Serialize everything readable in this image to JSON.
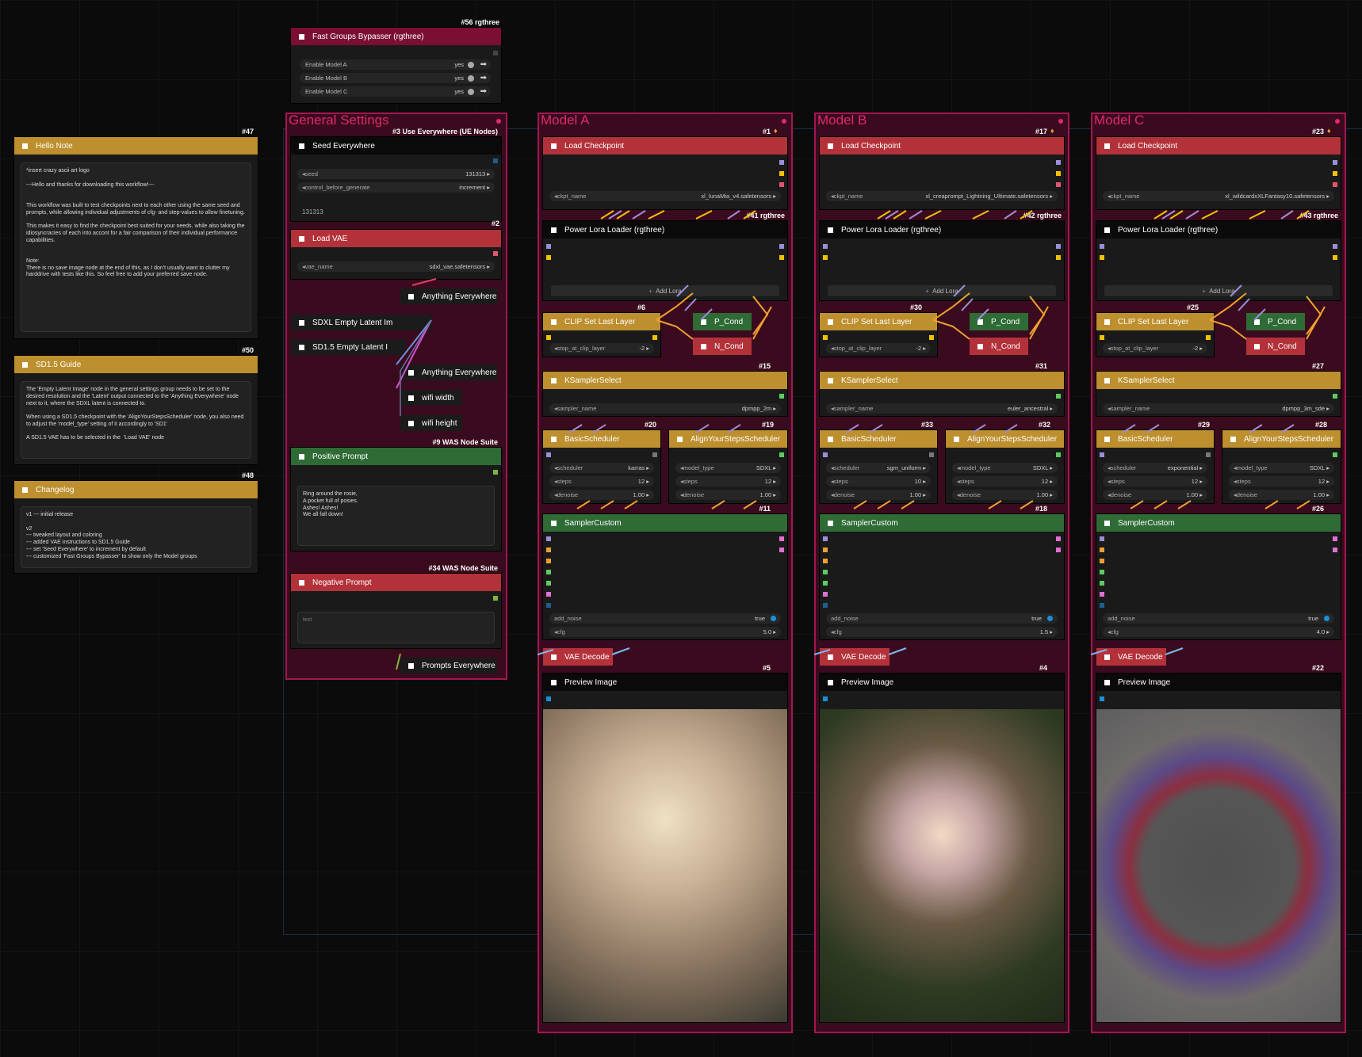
{
  "bypasser": {
    "id": "#56 rgthree",
    "title": "Fast Groups Bypasser (rgthree)",
    "toggles": [
      {
        "label": "Enable Model A",
        "value": "yes"
      },
      {
        "label": "Enable Model B",
        "value": "yes"
      },
      {
        "label": "Enable Model C",
        "value": "yes"
      }
    ]
  },
  "notes": {
    "hello": {
      "id": "#47",
      "title": "Hello Note",
      "text": "*insert crazy ascii art logo\n\n---Hello and thanks for downloading this workflow!---\n\n\nThis workflow was built to test checkpoints next to each other using the same seed and prompts, while allowing individual adjustments of cfg- and step-values to allow finetuning.\n\nThis makes it easy to find the checkpoint best suited for your needs, while also taking the idiosyncracies of each into accont for a fair comparison of their individual performance capabilities.\n\n\nNote:\nThere is no save image node at the end of this, as I don't usually want to clutter my harddrive with tests like this. So feel free to add your preferred save node."
    },
    "sd15": {
      "id": "#50",
      "title": "SD1.5 Guide",
      "text": "The 'Empty Latent Image' node in the general settings group needs to be set to the desired resolution and the 'Latent' output connected to the 'Anything Everywhere' node next to it, where the SDXL latent is connected to.\n\nWhen using a SD1.5 checkpoint with the 'AlignYourStepsScheduler' node, you also need to adjust the 'model_type' setting of it accordingly to 'SD1'\n\nA SD1.5 VAE has to be selected in the  'Load VAE' node"
    },
    "changelog": {
      "id": "#48",
      "title": "Changelog",
      "text": "v1 --- initial release\n\nv2\n--- tweaked layout and coloring\n--- added VAE instructions to SD1.5 Guide\n--- set 'Seed Everywhere' to increment by default\n--- customized 'Fast Groups Bypasser' to show only the Model groups"
    }
  },
  "general": {
    "title": "General Settings",
    "seed_node": {
      "id": "#3 Use Everywhere (UE Nodes)",
      "title": "Seed Everywhere",
      "seed_label": "seed",
      "seed_value": "131313",
      "cbg_label": "control_before_generate",
      "cbg_value": "increment",
      "display": "131313"
    },
    "vae_node": {
      "id": "#2",
      "title": "Load VAE",
      "label": "vae_name",
      "value": "sdxl_vae.safetensors"
    },
    "anything1": "Anything Everywhere",
    "sdxl_latent": "SDXL Empty Latent Im",
    "sd15_latent": "SD1.5 Empty Latent I",
    "anything2": "Anything Everywhere",
    "wifi_width": "wifi width",
    "wifi_height": "wifi height",
    "positive": {
      "id": "#9 WAS Node Suite",
      "title": "Positive Prompt",
      "text": "Ring around the rosie,\nA pocket full of posies.\nAshes! Ashes!\nWe all fall down!"
    },
    "negative": {
      "id": "#34 WAS Node Suite",
      "title": "Negative Prompt",
      "placeholder": "text"
    },
    "prompts_everywhere": "Prompts Everywhere"
  },
  "models": [
    {
      "title": "Model A",
      "ckpt_id": "#1",
      "ckpt_title": "Load Checkpoint",
      "ckpt_label": "ckpt_name",
      "ckpt_value": "xl_lunaMia_v4.safetensors",
      "lora_id": "#41 rgthree",
      "lora_title": "Power Lora Loader (rgthree)",
      "add_lora": "Add Lora",
      "clip_id": "#6",
      "clip_title": "CLIP Set Last Layer",
      "clip_label": "stop_at_clip_layer",
      "clip_value": "-2",
      "pcond": "P_Cond",
      "ncond": "N_Cond",
      "ks_id": "#15",
      "ks_title": "KSamplerSelect",
      "ks_label": "sampler_name",
      "ks_value": "dpmpp_2m",
      "bs_id": "#20",
      "bs_title": "BasicScheduler",
      "bs_sched": "karras",
      "bs_steps": "12",
      "bs_denoise": "1.00",
      "ay_id": "#19",
      "ay_title": "AlignYourStepsScheduler",
      "ay_model": "SDXL",
      "ay_steps": "12",
      "ay_denoise": "1.00",
      "sc_id": "#11",
      "sc_title": "SamplerCustom",
      "add_noise": "true",
      "cfg": "5.0",
      "vae_title": "VAE Decode",
      "prev_id": "#5",
      "prev_title": "Preview Image"
    },
    {
      "title": "Model B",
      "ckpt_id": "#17",
      "ckpt_title": "Load Checkpoint",
      "ckpt_label": "ckpt_name",
      "ckpt_value": "xl_creaprompt_Lightning_Ultimate.safetensors",
      "lora_id": "#42 rgthree",
      "lora_title": "Power Lora Loader (rgthree)",
      "add_lora": "Add Lora",
      "clip_id": "#30",
      "clip_title": "CLIP Set Last Layer",
      "clip_label": "stop_at_clip_layer",
      "clip_value": "-2",
      "pcond": "P_Cond",
      "ncond": "N_Cond",
      "ks_id": "#31",
      "ks_title": "KSamplerSelect",
      "ks_label": "sampler_name",
      "ks_value": "euler_ancestral",
      "bs_id": "#33",
      "bs_title": "BasicScheduler",
      "bs_sched": "sgm_uniform",
      "bs_steps": "10",
      "bs_denoise": "1.00",
      "ay_id": "#32",
      "ay_title": "AlignYourStepsScheduler",
      "ay_model": "SDXL",
      "ay_steps": "12",
      "ay_denoise": "1.00",
      "sc_id": "#18",
      "sc_title": "SamplerCustom",
      "add_noise": "true",
      "cfg": "1.5",
      "vae_title": "VAE Decode",
      "prev_id": "#4",
      "prev_title": "Preview Image"
    },
    {
      "title": "Model C",
      "ckpt_id": "#23",
      "ckpt_title": "Load Checkpoint",
      "ckpt_label": "ckpt_name",
      "ckpt_value": "xl_wildcardxXLFantasy10.safetensors",
      "lora_id": "#43 rgthree",
      "lora_title": "Power Lora Loader (rgthree)",
      "add_lora": "Add Lora",
      "clip_id": "#25",
      "clip_title": "CLIP Set Last Layer",
      "clip_label": "stop_at_clip_layer",
      "clip_value": "-2",
      "pcond": "P_Cond",
      "ncond": "N_Cond",
      "ks_id": "#27",
      "ks_title": "KSamplerSelect",
      "ks_label": "sampler_name",
      "ks_value": "dpmpp_3m_sde",
      "bs_id": "#29",
      "bs_title": "BasicScheduler",
      "bs_sched": "exponential",
      "bs_steps": "12",
      "bs_denoise": "1.00",
      "ay_id": "#28",
      "ay_title": "AlignYourStepsScheduler",
      "ay_model": "SDXL",
      "ay_steps": "12",
      "ay_denoise": "1.00",
      "sc_id": "#26",
      "sc_title": "SamplerCustom",
      "add_noise": "true",
      "cfg": "4.0",
      "vae_title": "VAE Decode",
      "prev_id": "#22",
      "prev_title": "Preview Image"
    }
  ],
  "labels": {
    "scheduler": "scheduler",
    "steps": "steps",
    "denoise": "denoise",
    "model_type": "model_type",
    "add_noise": "add_noise",
    "cfg": "cfg"
  }
}
